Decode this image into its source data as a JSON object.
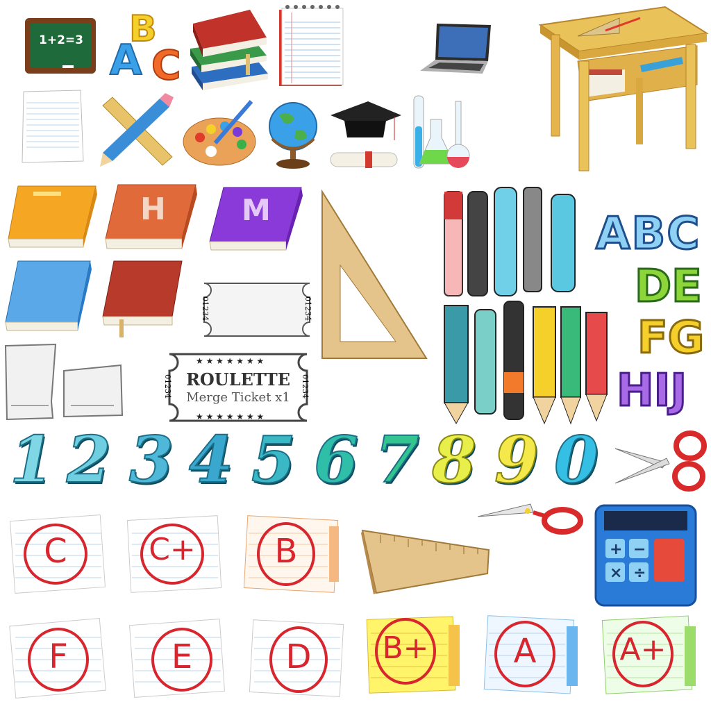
{
  "blackboard": {
    "equation": "1+2=3"
  },
  "abc_blocks": {
    "letters": [
      "A",
      "B",
      "C"
    ]
  },
  "books": {
    "h_letter": "H",
    "m_letter": "M"
  },
  "tickets": {
    "blank_serial_left": "01234",
    "blank_serial_right": "01234",
    "main_serial_left": "01234",
    "main_serial_right": "01234",
    "main_title": "ROULETTE",
    "main_subtitle": "Merge Ticket x1"
  },
  "alphabet_letters": {
    "row1": "ABC",
    "row2": "DE",
    "row3": "FG",
    "row4": "HIJ"
  },
  "numbers": [
    {
      "label": "1",
      "color": "#7fd7e6"
    },
    {
      "label": "2",
      "color": "#6fcfe0"
    },
    {
      "label": "3",
      "color": "#4fb8d8"
    },
    {
      "label": "4",
      "color": "#3aa7cf"
    },
    {
      "label": "5",
      "color": "#3bb8c6"
    },
    {
      "label": "6",
      "color": "#2fbfa8"
    },
    {
      "label": "7",
      "color": "#34c48f"
    },
    {
      "label": "8",
      "color": "#e9ef4a"
    },
    {
      "label": "9",
      "color": "#f5e84a"
    },
    {
      "label": "0",
      "color": "#35bfe5"
    }
  ],
  "grades": [
    {
      "label": "C",
      "paper": "#ffffff",
      "tab": "#e6eef5"
    },
    {
      "label": "C+",
      "paper": "#ffffff",
      "tab": "#e6eef5"
    },
    {
      "label": "B",
      "paper": "#fff7ee",
      "tab": "#f5b880"
    },
    {
      "label": "F",
      "paper": "#ffffff",
      "tab": "#dde4ea"
    },
    {
      "label": "E",
      "paper": "#ffffff",
      "tab": "#dde4ea"
    },
    {
      "label": "D",
      "paper": "#ffffff",
      "tab": "#dde4ea"
    },
    {
      "label": "B+",
      "paper": "#fff46a",
      "tab": "#f6c34a"
    },
    {
      "label": "A",
      "paper": "#eef7ff",
      "tab": "#6cb6f0"
    },
    {
      "label": "A+",
      "paper": "#eefde8",
      "tab": "#9bdc6a"
    }
  ],
  "colors": {
    "grade_ink": "#d8262f",
    "number_outline": "#1b6f86"
  }
}
